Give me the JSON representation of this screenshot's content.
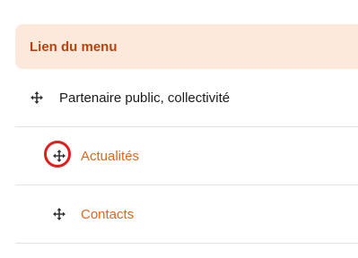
{
  "panel": {
    "title": "Lien du menu"
  },
  "items": [
    {
      "label": "Partenaire public, collectivité",
      "icon": "drag-move-icon",
      "style": "plain"
    },
    {
      "label": "Actualités",
      "icon": "drag-move-icon",
      "style": "link",
      "highlighted": true
    },
    {
      "label": "Contacts",
      "icon": "drag-move-icon",
      "style": "link"
    }
  ],
  "colors": {
    "header_bg": "#fce9dc",
    "header_text": "#b8420d",
    "link": "#e0661c",
    "highlight": "#e11d1d",
    "divider": "#e3e3e3"
  }
}
